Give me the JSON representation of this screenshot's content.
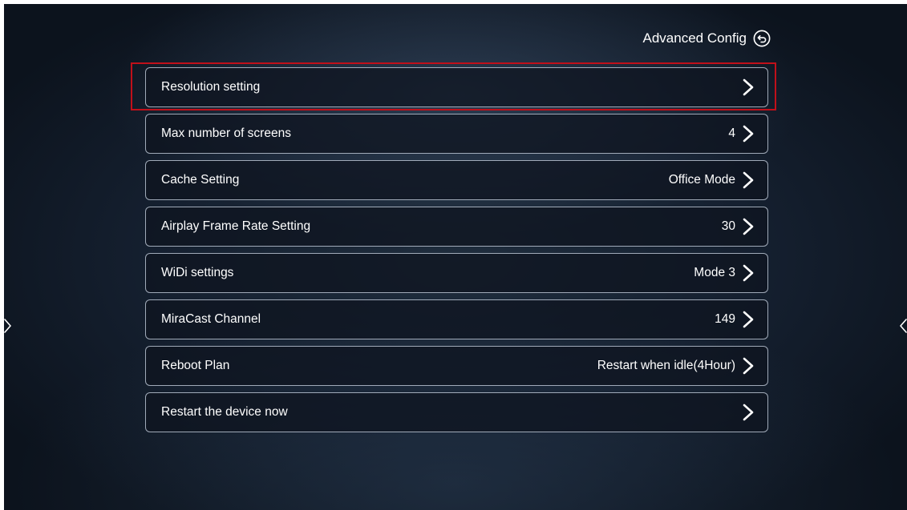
{
  "header": {
    "title": "Advanced Config",
    "back_icon": "back-circle-icon"
  },
  "settings": {
    "items": [
      {
        "label": "Resolution setting",
        "value": ""
      },
      {
        "label": "Max number of screens",
        "value": "4"
      },
      {
        "label": "Cache Setting",
        "value": "Office Mode"
      },
      {
        "label": "Airplay Frame Rate Setting",
        "value": "30"
      },
      {
        "label": "WiDi settings",
        "value": "Mode 3"
      },
      {
        "label": "MiraCast Channel",
        "value": "149"
      },
      {
        "label": "Reboot Plan",
        "value": "Restart when idle(4Hour)"
      },
      {
        "label": "Restart the device now",
        "value": ""
      }
    ],
    "selected_index": 0
  },
  "colors": {
    "highlight": "#c0101a",
    "row_border": "#d2dceb",
    "text": "#ffffff"
  }
}
